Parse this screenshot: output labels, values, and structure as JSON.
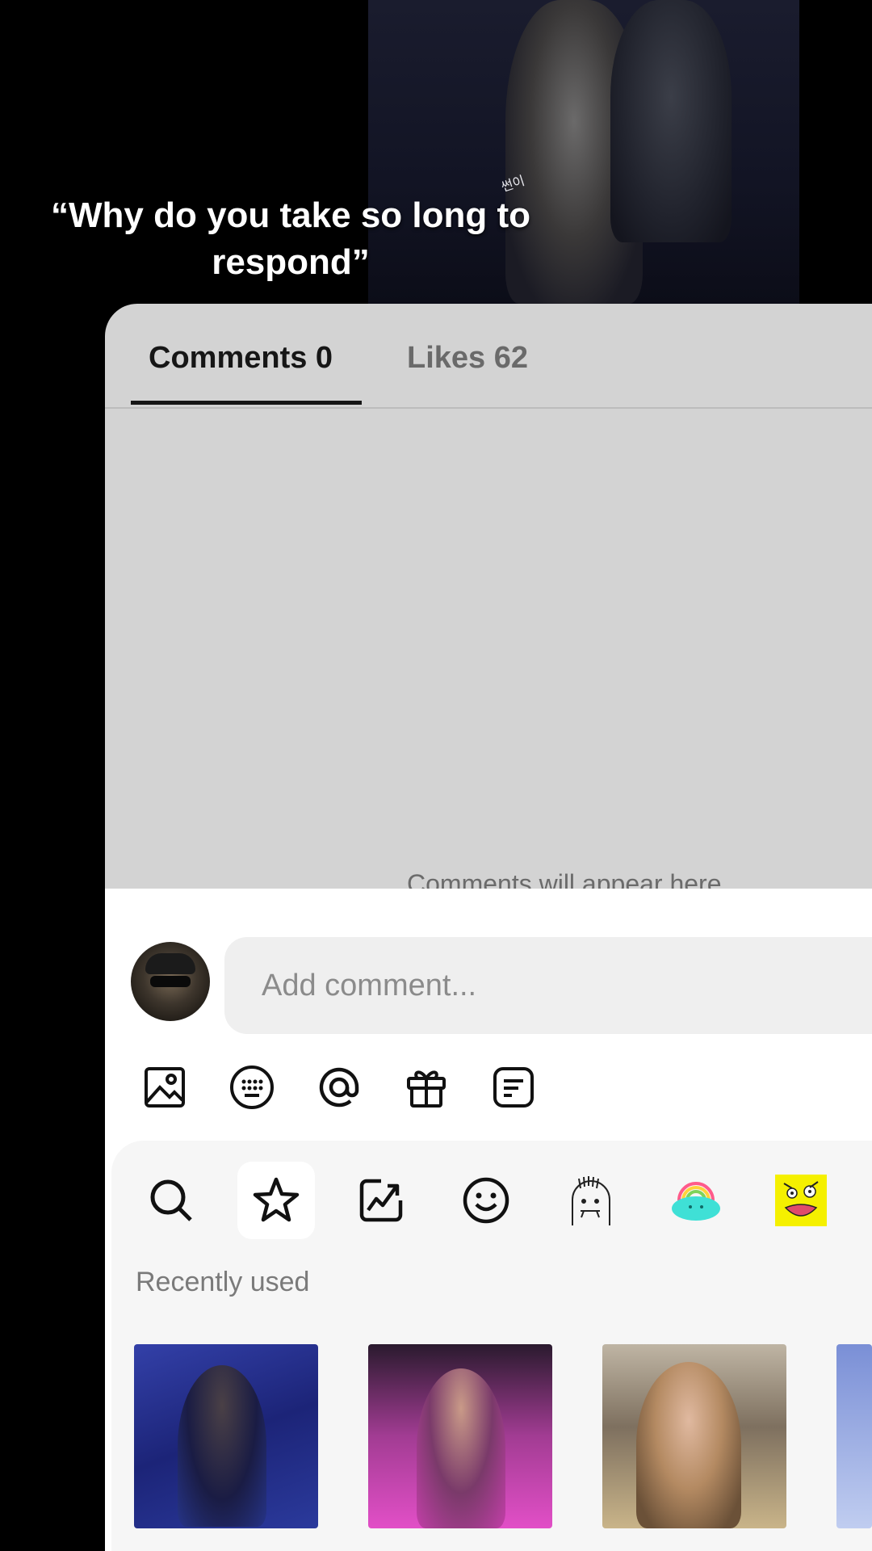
{
  "video": {
    "caption": "“Why do you take so long to respond”",
    "watermark": "썬이"
  },
  "sheet": {
    "tabs": [
      {
        "label": "Comments 0",
        "active": true
      },
      {
        "label": "Likes 62",
        "active": false
      }
    ],
    "empty_hint": "Comments will appear here"
  },
  "composer": {
    "placeholder": "Add comment...",
    "toolbar": [
      "image-icon",
      "emoji-keyboard-icon",
      "mention-icon",
      "gift-icon",
      "template-icon"
    ]
  },
  "sticker_panel": {
    "tabs": [
      "search-icon",
      "star-icon",
      "trending-icon",
      "smiley-icon",
      "doodle-face-sticker",
      "rainbow-cloud-sticker",
      "yellow-face-sticker"
    ],
    "selected_tab": "star-icon",
    "recent_label": "Recently used",
    "thumbnails": [
      "gif-performer-blue",
      "gif-performer-pink",
      "gif-woman-gold",
      "gif-partial-blue"
    ]
  },
  "colors": {
    "sheet_bg": "#d3d3d3",
    "panel_bg": "#f6f6f6",
    "active_tab": "#161616",
    "inactive_tab": "#6a6a6a"
  }
}
